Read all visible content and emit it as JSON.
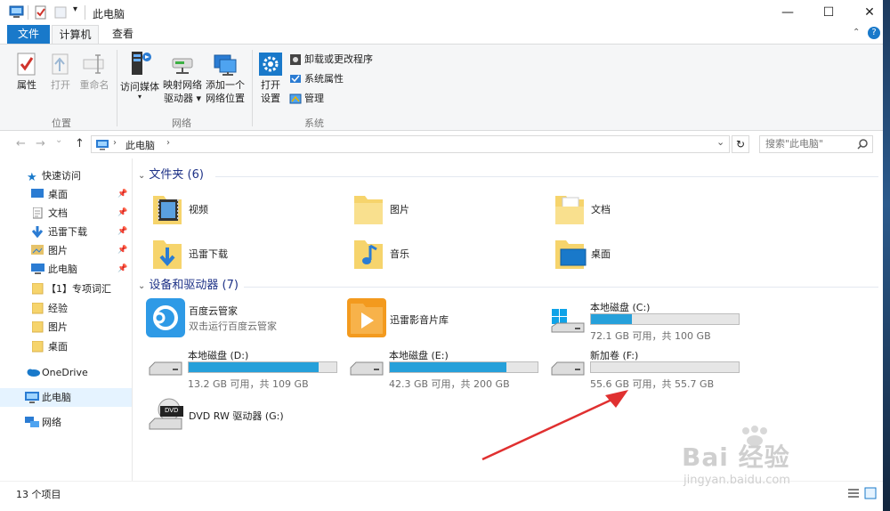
{
  "window": {
    "title": "此电脑",
    "controls": {
      "minimize": "—",
      "maximize": "☐",
      "close": "✕"
    }
  },
  "ribbon": {
    "tabs": [
      "文件",
      "计算机",
      "查看"
    ],
    "location_group": {
      "label": "位置",
      "properties": "属性",
      "open": "打开",
      "rename": "重命名"
    },
    "network_group": {
      "label": "网络",
      "access_media": "访问媒体",
      "map_drive_1": "映射网络",
      "map_drive_2": "驱动器 ▾",
      "add_location_1": "添加一个",
      "add_location_2": "网络位置"
    },
    "system_group": {
      "label": "系统",
      "open_settings_1": "打开",
      "open_settings_2": "设置",
      "uninstall": "卸载或更改程序",
      "system_properties": "系统属性",
      "manage": "管理"
    }
  },
  "address": {
    "back": "←",
    "forward": "→",
    "recent": "⌄",
    "up": "↑",
    "path": "此电脑",
    "sep": "›",
    "dropdown": "⌄",
    "refresh": "↻",
    "search_placeholder": "搜索\"此电脑\""
  },
  "sidebar": {
    "quick_access": "快速访问",
    "items": [
      {
        "label": "桌面",
        "pinned": true
      },
      {
        "label": "文档",
        "pinned": true
      },
      {
        "label": "迅雷下载",
        "pinned": true
      },
      {
        "label": "图片",
        "pinned": true
      },
      {
        "label": "此电脑",
        "pinned": true
      },
      {
        "label": "【1】专项词汇",
        "pinned": false
      },
      {
        "label": "经验",
        "pinned": false
      },
      {
        "label": "图片",
        "pinned": false
      },
      {
        "label": "桌面",
        "pinned": false
      }
    ],
    "onedrive": "OneDrive",
    "this_pc": "此电脑",
    "network": "网络"
  },
  "content": {
    "folders_header": "文件夹 (6)",
    "folders": [
      "视频",
      "图片",
      "文档",
      "迅雷下载",
      "音乐",
      "桌面"
    ],
    "drives_header": "设备和驱动器 (7)",
    "apps": [
      {
        "name": "百度云管家",
        "sub": "双击运行百度云管家"
      },
      {
        "name": "迅雷影音片库"
      }
    ],
    "drives": [
      {
        "name": "本地磁盘 (C:)",
        "free": "72.1 GB 可用，共 100 GB",
        "used_fraction": 0.28
      },
      {
        "name": "本地磁盘 (D:)",
        "free": "13.2 GB 可用，共 109 GB",
        "used_fraction": 0.88
      },
      {
        "name": "本地磁盘 (E:)",
        "free": "42.3 GB 可用，共 200 GB",
        "used_fraction": 0.79
      },
      {
        "name": "新加卷 (F:)",
        "free": "55.6 GB 可用，共 55.7 GB",
        "used_fraction": 0.0
      }
    ],
    "dvd": "DVD RW 驱动器 (G:)",
    "dvd_badge": "DVD"
  },
  "status": {
    "count": "13 个项目"
  },
  "watermark": {
    "brand": "Bai  经验",
    "url": "jingyan.baidu.com"
  },
  "colors": {
    "accent": "#1979ca",
    "usage_bar": "#26a0da",
    "header_text": "#1e3287",
    "arrow": "#e03030"
  }
}
